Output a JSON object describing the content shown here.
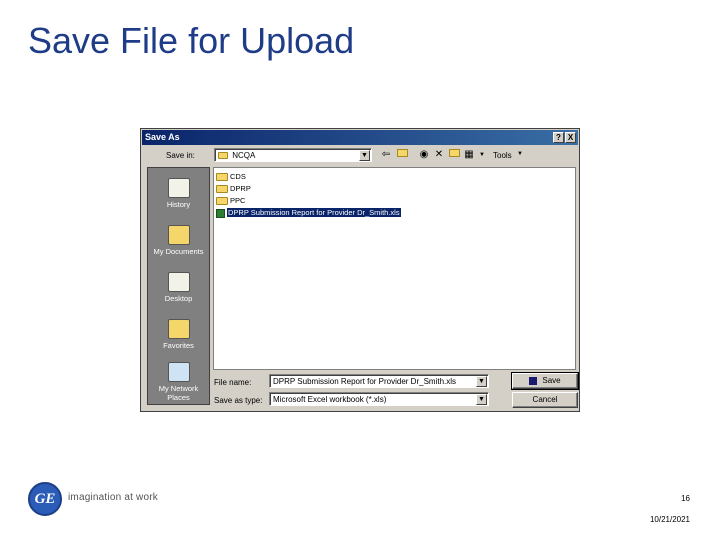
{
  "slide": {
    "title": "Save File for Upload",
    "page_number": "16",
    "date": "10/21/2021",
    "brand_tagline": "imagination at work",
    "logo_text": "GE"
  },
  "dialog": {
    "title": "Save As",
    "help_button": "?",
    "close_button": "X",
    "save_in_label": "Save in:",
    "save_in_value": "NCQA",
    "tools_label": "Tools",
    "places": [
      {
        "label": "History",
        "icon": "history-icon"
      },
      {
        "label": "My Documents",
        "icon": "my-documents-icon"
      },
      {
        "label": "Desktop",
        "icon": "desktop-icon"
      },
      {
        "label": "Favorites",
        "icon": "favorites-icon"
      },
      {
        "label": "My Network Places",
        "icon": "network-places-icon"
      }
    ],
    "files": [
      {
        "name": "CDS",
        "type": "folder"
      },
      {
        "name": "DPRP",
        "type": "folder"
      },
      {
        "name": "PPC",
        "type": "folder"
      },
      {
        "name": "DPRP Submission Report for Provider Dr_Smith.xls",
        "type": "excel",
        "selected": true
      }
    ],
    "file_name_label": "File name:",
    "file_name_value": "DPRP Submission Report for Provider Dr_Smith.xls",
    "save_as_type_label": "Save as type:",
    "save_as_type_value": "Microsoft Excel workbook (*.xls)",
    "save_button": "Save",
    "cancel_button": "Cancel"
  },
  "colors": {
    "title_blue": "#1f3c88",
    "titlebar_start": "#0a246a",
    "selection": "#0a246a",
    "dialog_face": "#d4d0c8"
  }
}
